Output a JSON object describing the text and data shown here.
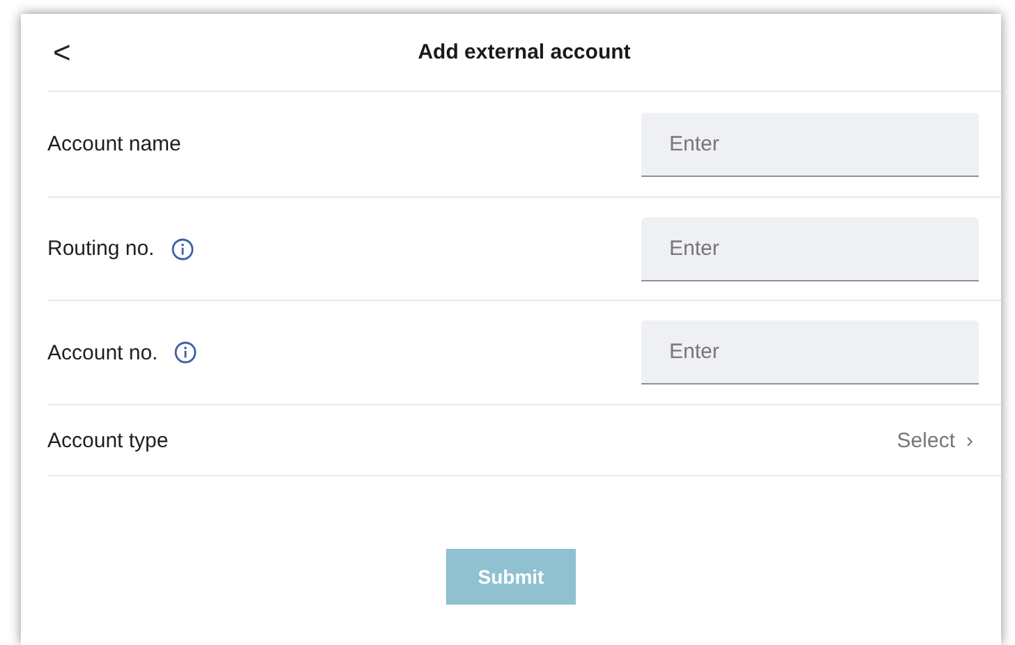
{
  "header": {
    "back": "<",
    "title": "Add external account"
  },
  "rows": [
    {
      "kind": "input",
      "label": "Account name",
      "info": false,
      "placeholder": "Enter"
    },
    {
      "kind": "input",
      "label": "Routing no.",
      "info": true,
      "placeholder": "Enter"
    },
    {
      "kind": "input",
      "label": "Account no.",
      "info": true,
      "placeholder": "Enter"
    },
    {
      "kind": "select",
      "label": "Account type",
      "value": "Select",
      "chevron": "›"
    }
  ],
  "submit": {
    "label": "Submit",
    "disabled": true
  }
}
